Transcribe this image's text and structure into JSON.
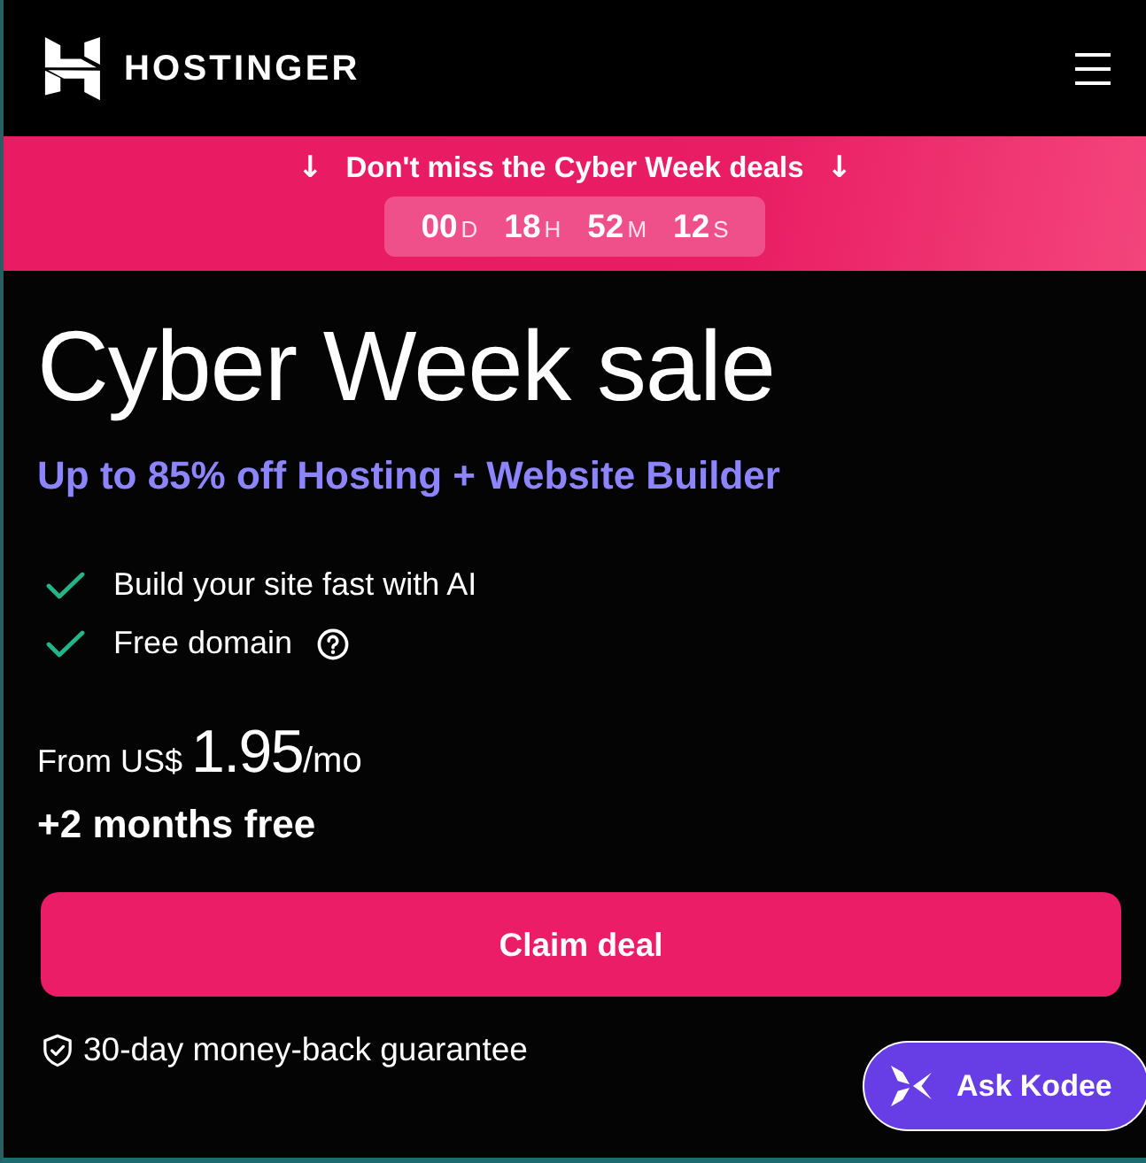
{
  "header": {
    "brand": "HOSTINGER"
  },
  "promo_banner": {
    "arrow_left": "↓",
    "text": "Don't miss the Cyber Week deals",
    "arrow_right": "↓",
    "countdown": [
      {
        "value": "00",
        "unit": "D"
      },
      {
        "value": "18",
        "unit": "H"
      },
      {
        "value": "52",
        "unit": "M"
      },
      {
        "value": "12",
        "unit": "S"
      }
    ]
  },
  "hero": {
    "title": "Cyber Week sale",
    "subtitle": "Up to 85% off Hosting + Website Builder",
    "features": [
      {
        "text": "Build your site fast with AI",
        "info": false
      },
      {
        "text": "Free domain",
        "info": true
      }
    ],
    "price": {
      "prefix": "From US$",
      "amount": "1.95",
      "suffix": "/mo"
    },
    "bonus": "+2 months free",
    "cta": "Claim deal",
    "guarantee": "30-day money-back guarantee"
  },
  "chat_button": {
    "label": "Ask Kodee"
  }
}
